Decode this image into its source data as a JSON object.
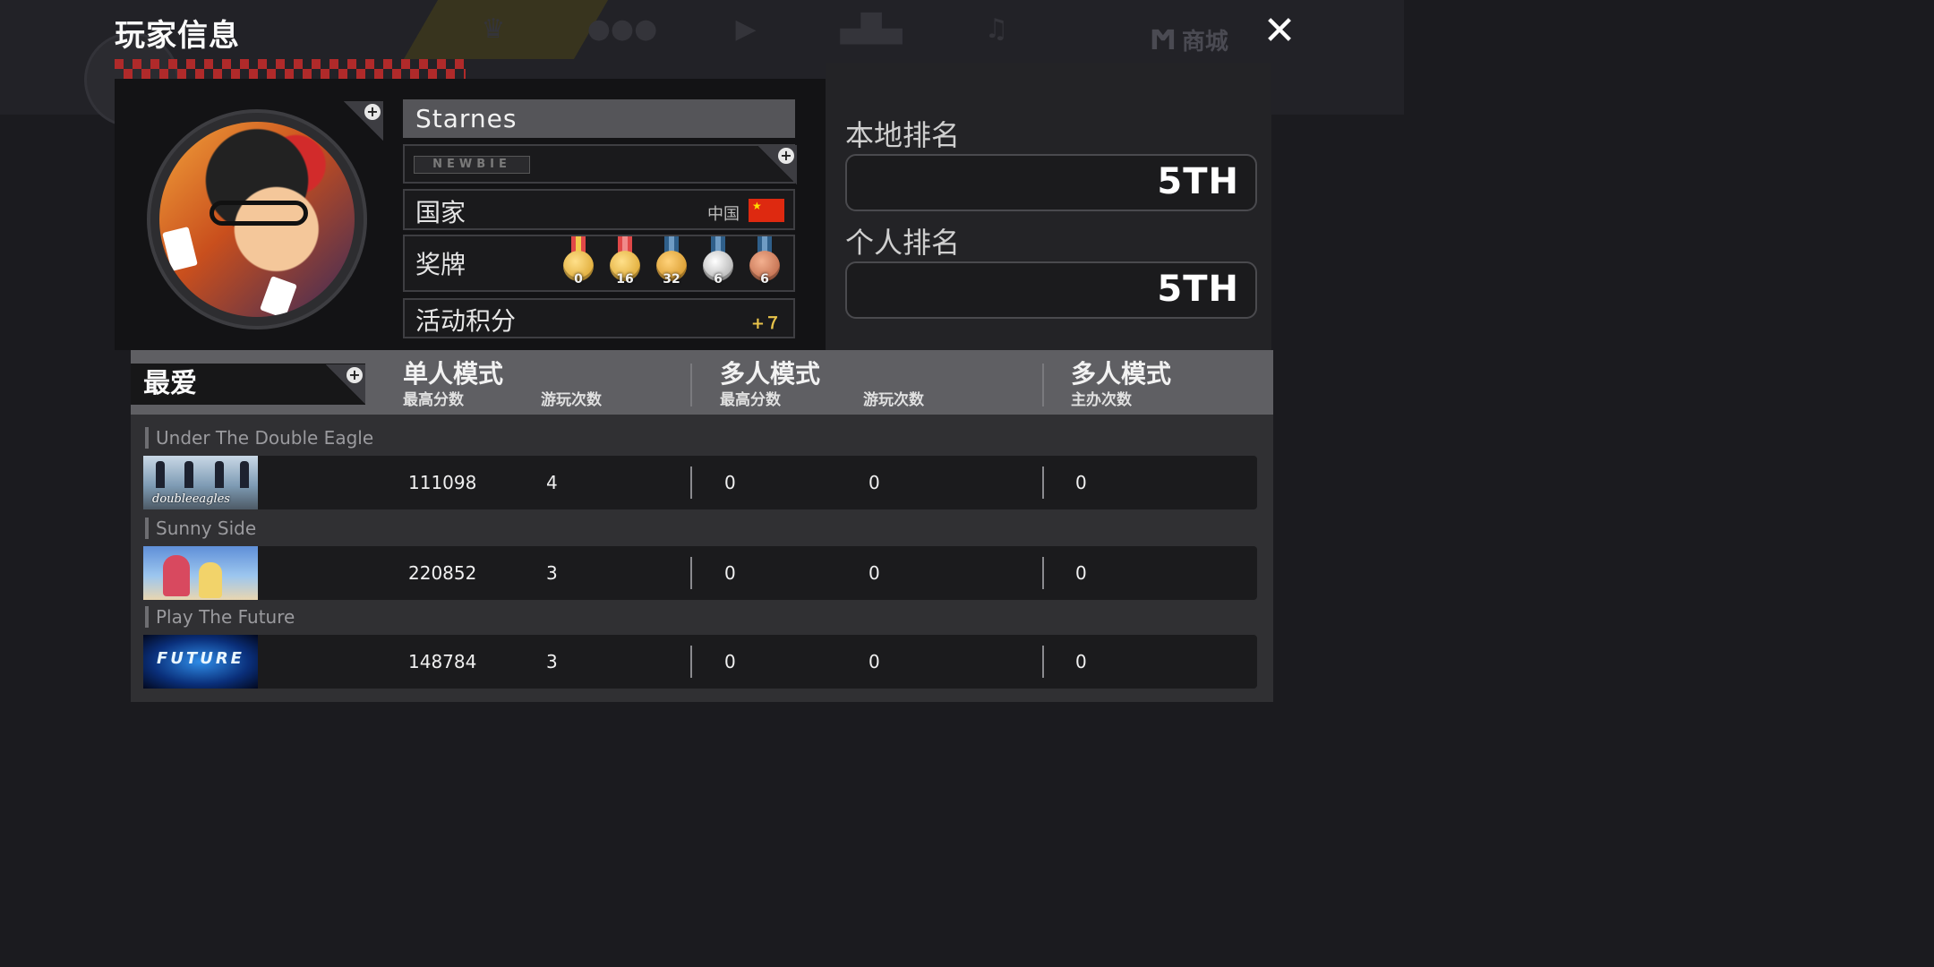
{
  "title": "玩家信息",
  "close_label": "✕",
  "background_nav": {
    "shop_label": "商城"
  },
  "profile": {
    "name": "Starnes",
    "badge": "NEWBIE",
    "country_label": "国家",
    "country_value": "中国",
    "medal_label": "奖牌",
    "medals": [
      {
        "type": "gold-red",
        "count": "0"
      },
      {
        "type": "gold-red",
        "count": "16"
      },
      {
        "type": "gold-blue",
        "count": "32"
      },
      {
        "type": "silver",
        "count": "6"
      },
      {
        "type": "bronze",
        "count": "6"
      }
    ],
    "event_label": "活动积分",
    "event_value": "+７"
  },
  "ranks": {
    "local_label": "本地排名",
    "local_value": "5TH",
    "personal_label": "个人排名",
    "personal_value": "5TH"
  },
  "favorites": {
    "tab_label": "最爱",
    "columns": {
      "single": {
        "title": "单人模式",
        "high": "最高分数",
        "plays": "游玩次数"
      },
      "multi": {
        "title": "多人模式",
        "high": "最高分数",
        "plays": "游玩次数"
      },
      "host": {
        "title": "多人模式",
        "hosted": "主办次数"
      }
    },
    "songs": [
      {
        "title": "Under The Double Eagle",
        "thumb_text": "doubleeagles",
        "single_high": "111098",
        "single_plays": "4",
        "multi_high": "0",
        "multi_plays": "0",
        "hosted": "0"
      },
      {
        "title": "Sunny Side",
        "thumb_text": "",
        "single_high": "220852",
        "single_plays": "3",
        "multi_high": "0",
        "multi_plays": "0",
        "hosted": "0"
      },
      {
        "title": "Play The Future",
        "thumb_text": "FUTURE",
        "single_high": "148784",
        "single_plays": "3",
        "multi_high": "0",
        "multi_plays": "0",
        "hosted": "0"
      }
    ]
  },
  "colors": {
    "accent_red": "#b02a2a",
    "event_gold": "#e8c34a"
  }
}
